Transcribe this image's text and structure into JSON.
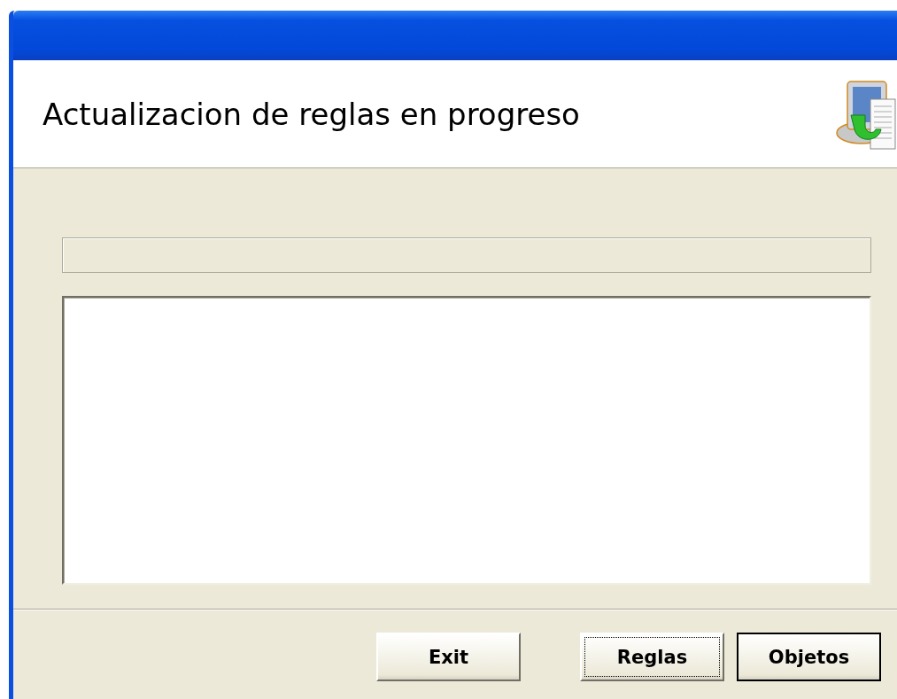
{
  "header": {
    "title": "Actualizacion de reglas en progreso"
  },
  "progress": {
    "level": 0
  },
  "buttons": [
    {
      "label": "Exit",
      "focused": false,
      "default": false
    },
    {
      "label": "Reglas",
      "focused": true,
      "default": false
    },
    {
      "label": "Objetos",
      "focused": false,
      "default": true
    }
  ]
}
